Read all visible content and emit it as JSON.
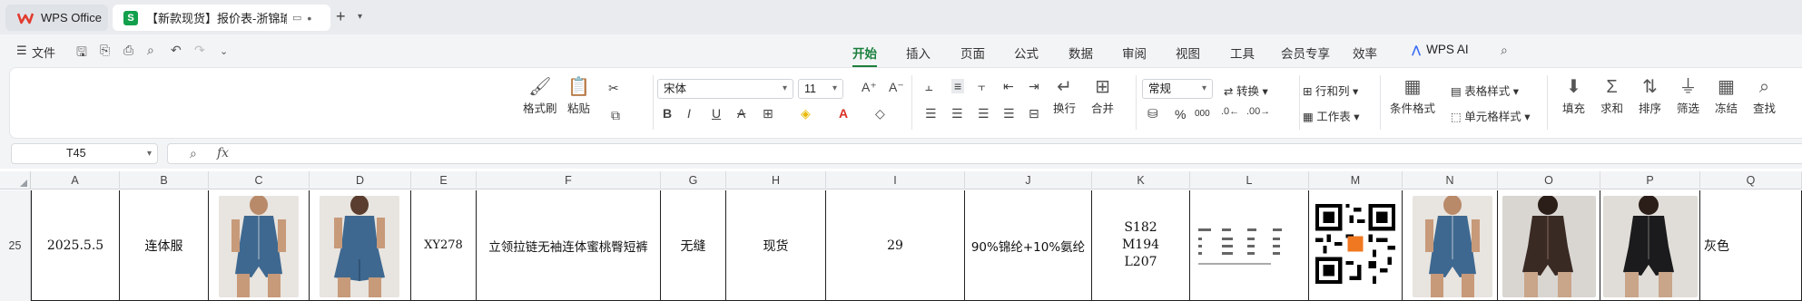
{
  "tabs": {
    "home_label": "WPS Office",
    "doc_label": "【新款现货】报价表-浙锦瑜伽",
    "doc_badge": "S"
  },
  "menubar": {
    "file_label": "文件",
    "ribbon_tabs": [
      "开始",
      "插入",
      "页面",
      "公式",
      "数据",
      "审阅",
      "视图",
      "工具",
      "会员专享",
      "效率"
    ],
    "active_tab": "开始",
    "wps_ai_label": "WPS AI"
  },
  "ribbon": {
    "format_painter": "格式刷",
    "paste": "粘贴",
    "font_name": "宋体",
    "font_size": "11",
    "wrap": "换行",
    "merge": "合并",
    "number_format": "常规",
    "convert": "转换",
    "rows_cols": "行和列",
    "worksheet": "工作表",
    "cond_format": "条件格式",
    "table_style": "表格样式",
    "cell_style": "单元格样式",
    "fill": "填充",
    "sum": "求和",
    "sort": "排序",
    "filter": "筛选",
    "freeze": "冻结",
    "find": "查找",
    "percent": "%",
    "thousands": "000"
  },
  "formula_bar": {
    "name_box": "T45",
    "fx": "fx",
    "formula": ""
  },
  "sheet": {
    "columns": [
      "A",
      "B",
      "C",
      "D",
      "E",
      "F",
      "G",
      "H",
      "I",
      "J",
      "K",
      "L",
      "M",
      "N",
      "O",
      "P",
      "Q"
    ],
    "row_number": "25",
    "row": {
      "A": "2025.5.5",
      "B": "连体服",
      "E": "XY278",
      "F": "立领拉链无袖连体蜜桃臀短裤",
      "G": "无缝",
      "H": "现货",
      "I": "29",
      "J": "90%锦纶+10%氨纶",
      "K": [
        "S182",
        "M194",
        "L207"
      ],
      "Q": "灰色"
    }
  },
  "colors": {
    "accent": "#1a7f3c",
    "sheet_green": "#12a04c",
    "photo_blue": "#3e6890",
    "photo_brown": "#3a2a24",
    "photo_black": "#1b1b1d"
  }
}
